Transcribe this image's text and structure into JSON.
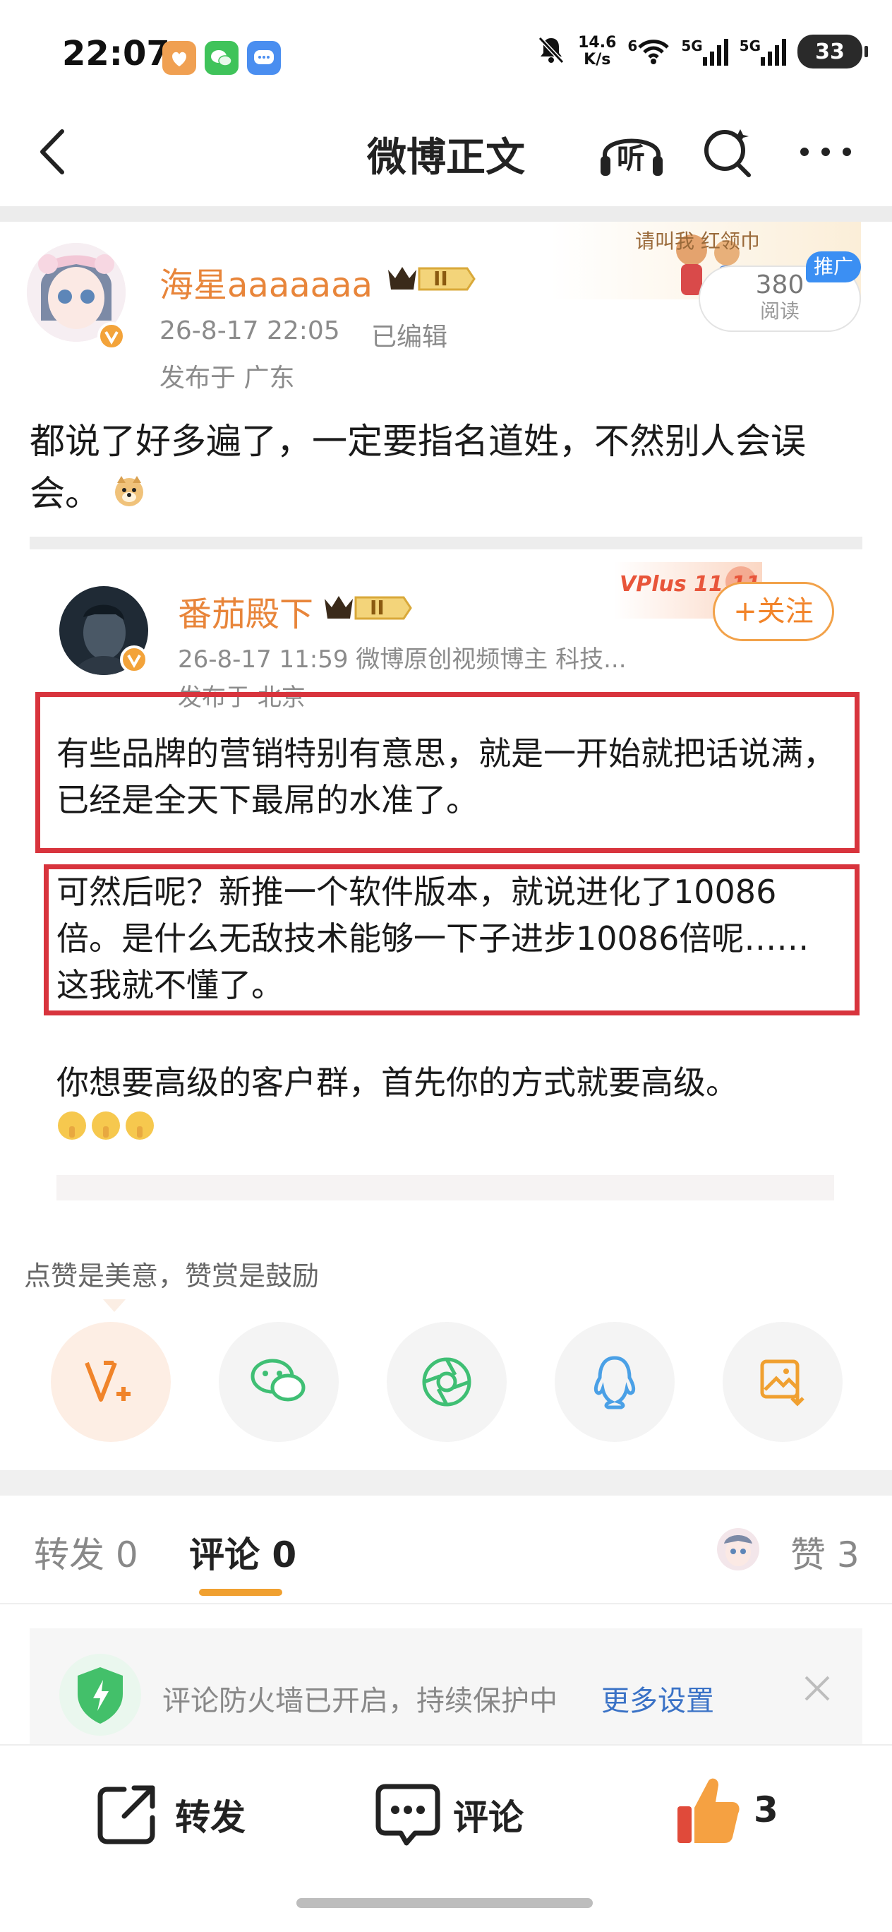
{
  "status_bar": {
    "time": "22:07",
    "net_speed_value": "14.6",
    "net_speed_unit": "K/s",
    "wifi_label": "6",
    "sim1": "5G",
    "sim2": "5G",
    "battery": "33"
  },
  "nav": {
    "title": "微博正文",
    "listen_label": "听"
  },
  "post": {
    "username": "海星aaaaaaa",
    "level": "II",
    "time": "26-8-17 22:05",
    "edited": "已编辑",
    "location": "发布于 广东",
    "read_count": "380",
    "read_label": "阅读",
    "promo_tag": "推广",
    "banner_text": "请叫我 红领巾",
    "text": "都说了好多遍了，一定要指名道姓，不然别人会误会。"
  },
  "repost": {
    "username": "番茄殿下",
    "level": "II",
    "meta": "26-8-17 11:59  微博原创视频博主 科技...",
    "location": "发布于 北京",
    "vplus_text": "VPlus 11.11",
    "follow_label": "+关注",
    "para1": "有些品牌的营销特别有意思，就是一开始就把话说满，已经是全天下最屌的水准了。",
    "para2": "可然后呢？新推一个软件版本，就说进化了10086倍。是什么无敌技术能够一下子进步10086倍呢……这我就不懂了。",
    "para3": "你想要高级的客户群，首先你的方式就要高级。"
  },
  "reward": {
    "text": "点赞是美意，赞赏是鼓励"
  },
  "tabs": {
    "repost": "转发 0",
    "comment": "评论 0",
    "likes": "赞 3"
  },
  "firewall": {
    "text": "评论防火墙已开启，持续保护中",
    "link": "更多设置"
  },
  "bottom_bar": {
    "repost": "转发",
    "comment": "评论",
    "like_count": "3"
  },
  "colors": {
    "accent_orange": "#e8853a",
    "highlight_red": "#d8343d",
    "link_blue": "#3a72c6"
  }
}
